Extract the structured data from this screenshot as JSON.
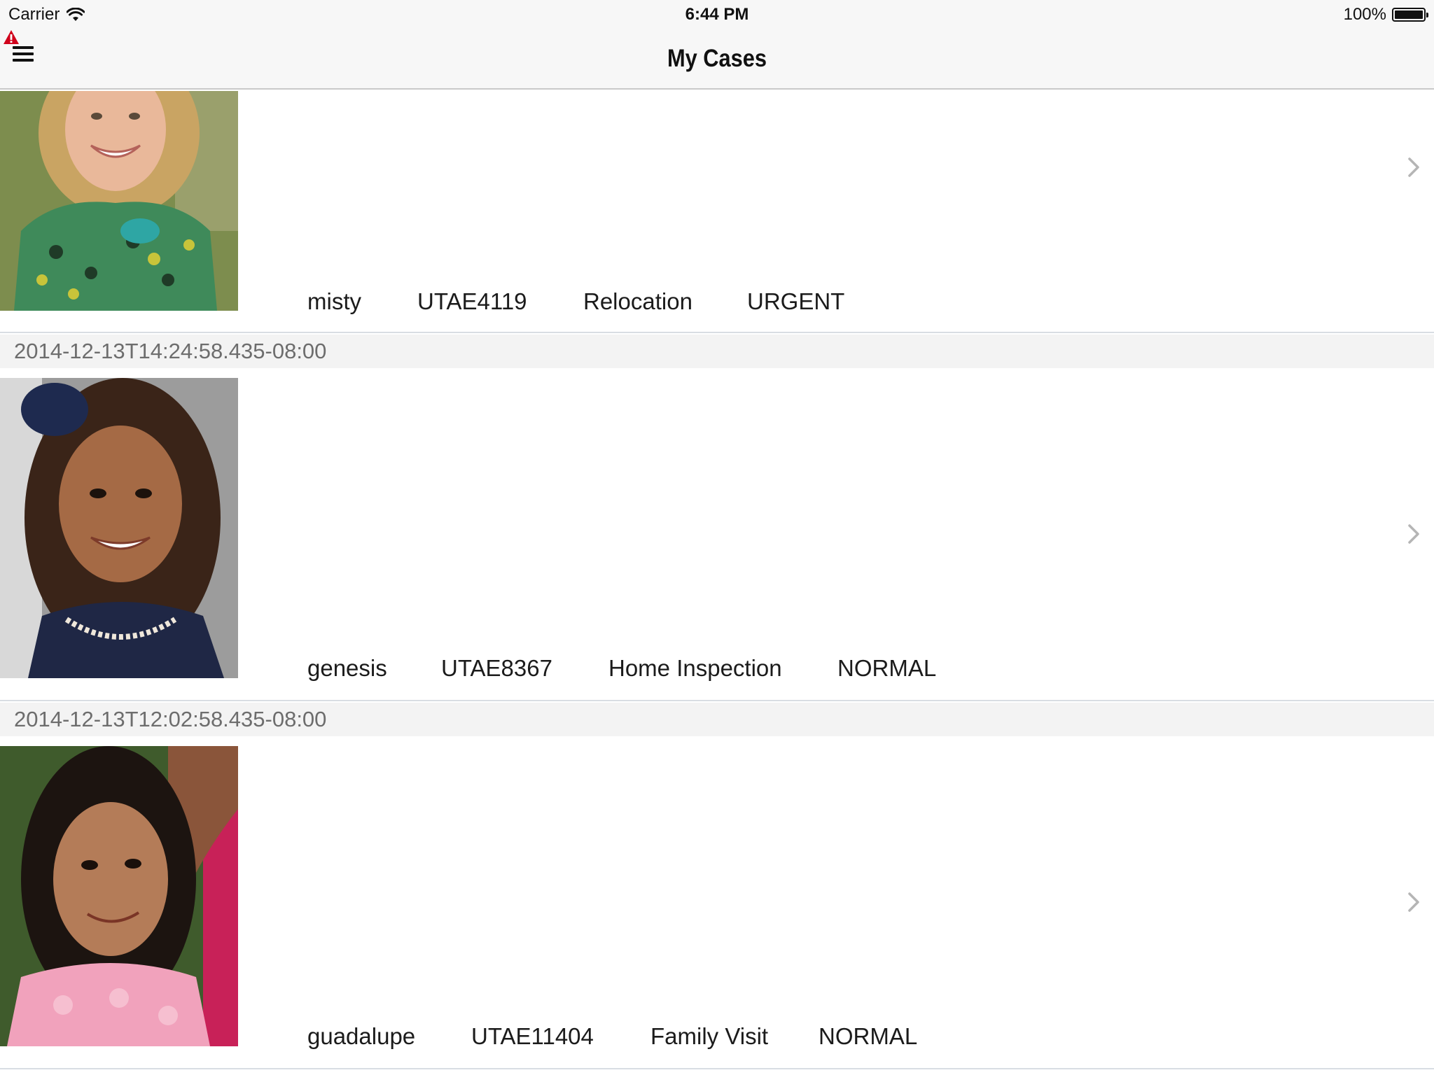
{
  "status_bar": {
    "carrier": "Carrier",
    "time": "6:44 PM",
    "battery": "100%"
  },
  "nav": {
    "title": "My Cases",
    "menu_icon": "hamburger-icon",
    "alert_icon": "warning-icon"
  },
  "sections": [
    {
      "header": "2014-12-13T14:24:58.435-08:00"
    },
    {
      "header": "2014-12-13T12:02:58.435-08:00"
    }
  ],
  "cases": [
    {
      "name": "misty",
      "case_id": "UTAE4119",
      "type": "Relocation",
      "priority": "URGENT",
      "photo": "child-photo-misty"
    },
    {
      "name": "genesis",
      "case_id": "UTAE8367",
      "type": "Home Inspection",
      "priority": "NORMAL",
      "photo": "child-photo-genesis"
    },
    {
      "name": "guadalupe",
      "case_id": "UTAE11404",
      "type": "Family Visit",
      "priority": "NORMAL",
      "photo": "child-photo-guadalupe"
    }
  ],
  "colors": {
    "nav_background": "#f7f7f7",
    "section_background": "#f3f3f3",
    "alert_red": "#d0021b",
    "chevron": "#b5b5b5"
  }
}
